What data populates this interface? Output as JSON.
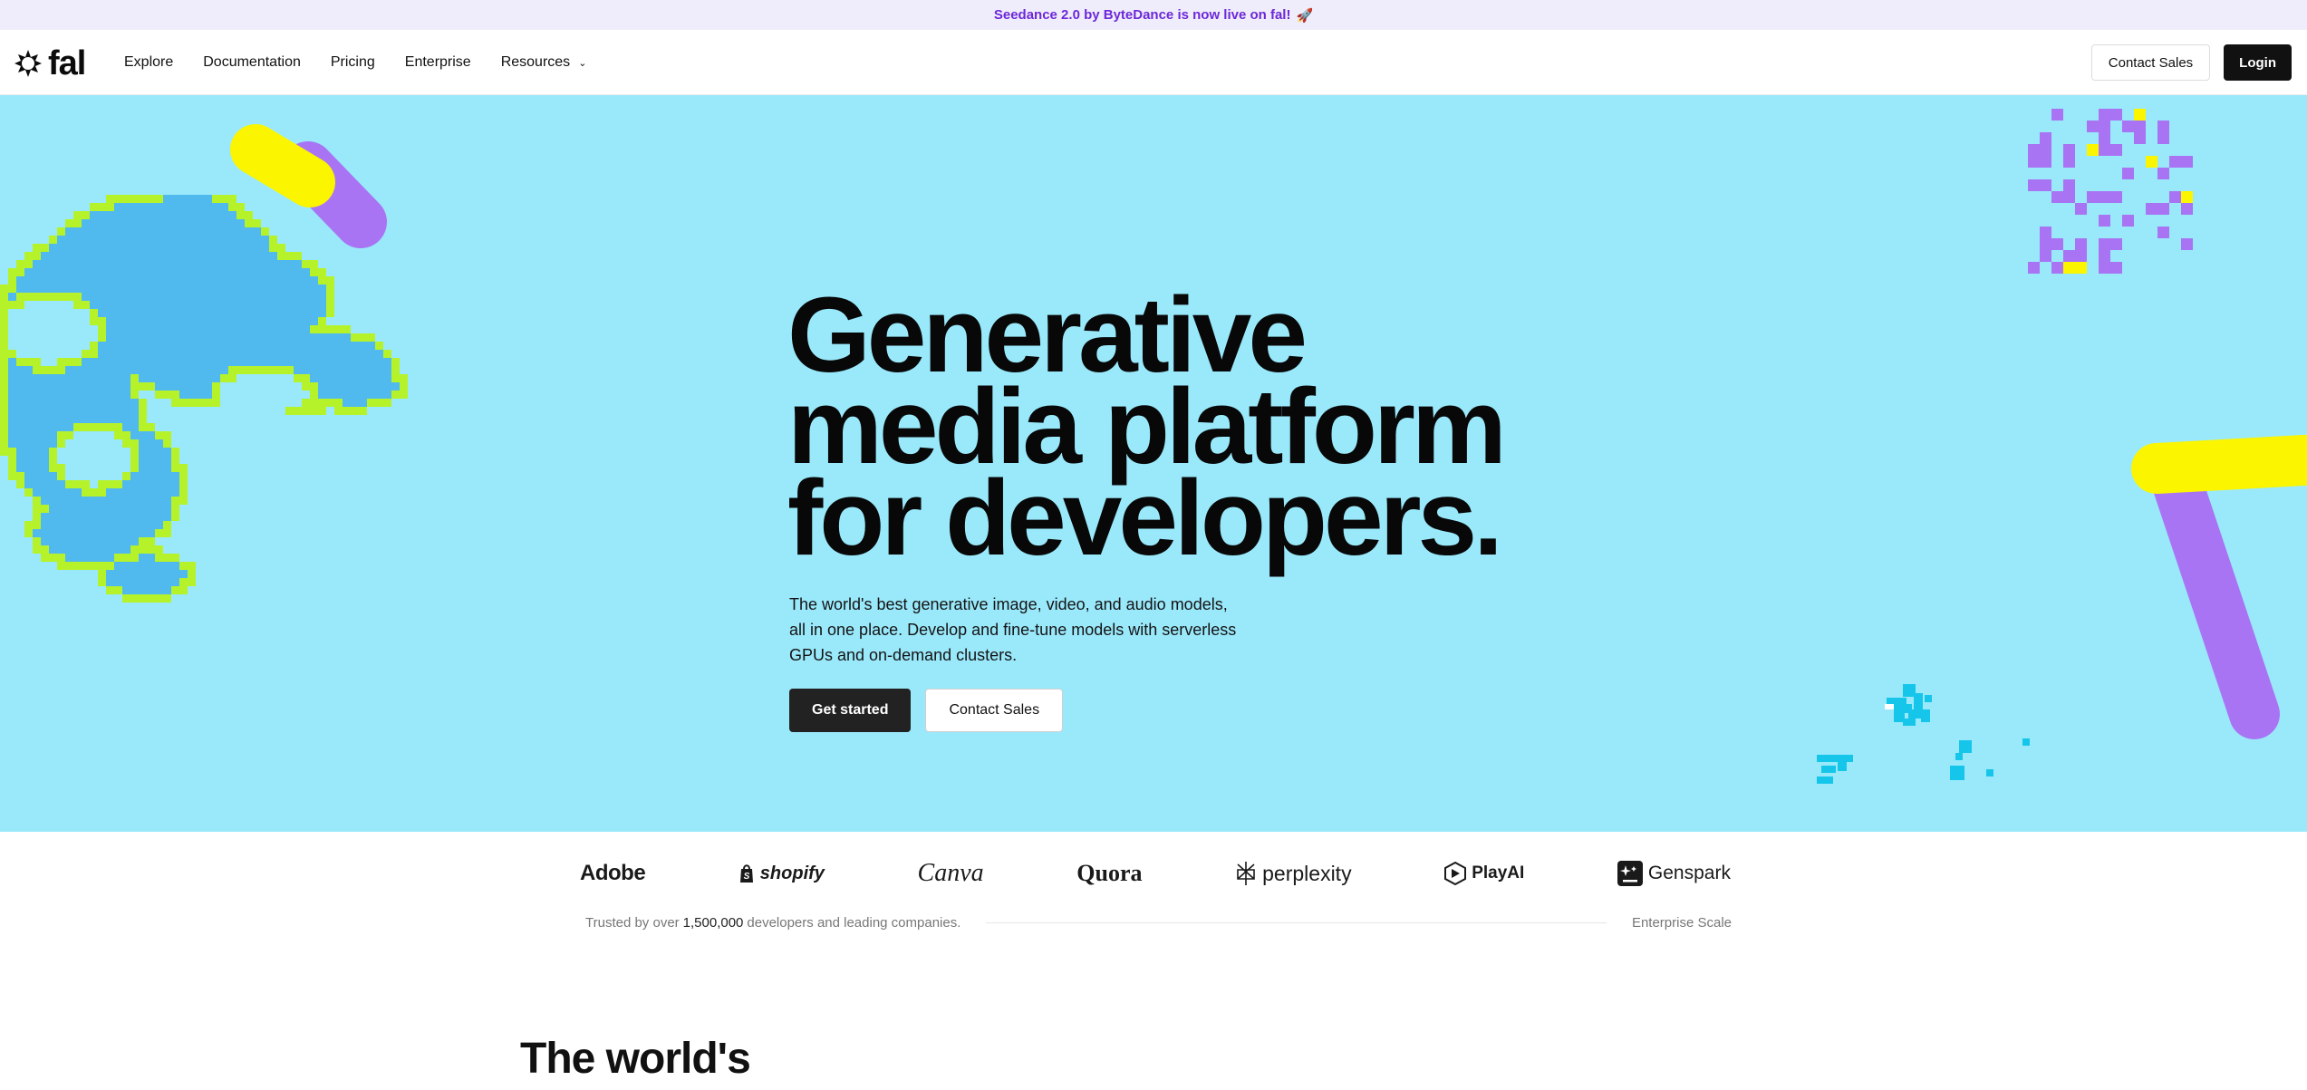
{
  "announcement": {
    "text": "Seedance 2.0 by ByteDance is now live on fal!",
    "emoji": "🚀"
  },
  "brand": {
    "name": "fal"
  },
  "nav": {
    "links": [
      "Explore",
      "Documentation",
      "Pricing",
      "Enterprise",
      "Resources"
    ],
    "contact_label": "Contact Sales",
    "login_label": "Login"
  },
  "hero": {
    "title_lines": [
      "Generative",
      "media platform",
      "for developers."
    ],
    "description": "The world's best generative image, video, and audio models, all in one place. Develop and fine-tune models with serverless GPUs and on-demand clusters.",
    "primary_cta": "Get started",
    "secondary_cta": "Contact Sales"
  },
  "logos": [
    "Adobe",
    "shopify",
    "Canva",
    "Quora",
    "perplexity",
    "PlayAI",
    "Genspark"
  ],
  "trust": {
    "prefix": "Trusted by over",
    "count": "1,500,000",
    "suffix": "developers and leading companies.",
    "right_label": "Enterprise Scale"
  },
  "section": {
    "title": "The world's"
  },
  "colors": {
    "hero_bg": "#9ae9fb",
    "announce_bg": "#efedfb",
    "announce_text": "#6d28d9",
    "yellow": "#fbf500",
    "purple": "#a874f4",
    "green": "#b6f22a",
    "blue": "#50b9ee",
    "cyan": "#16c6ea"
  }
}
